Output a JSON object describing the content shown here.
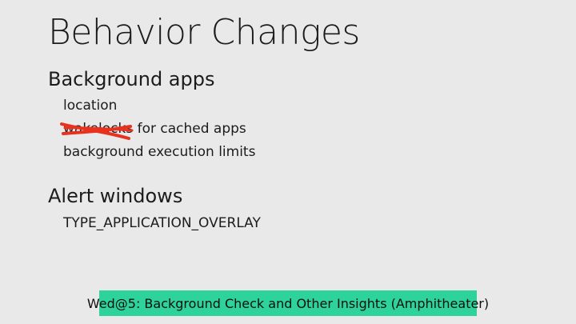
{
  "slide": {
    "title": "Behavior Changes",
    "sections": [
      {
        "heading": "Background apps",
        "items": [
          {
            "text": "location"
          },
          {
            "struck_text": "wakelocks",
            "text": " for cached apps"
          },
          {
            "text": "background execution limits"
          }
        ]
      },
      {
        "heading": "Alert windows",
        "items": [
          {
            "text": "TYPE_APPLICATION_OVERLAY"
          }
        ]
      }
    ]
  },
  "banner": {
    "text": "Wed@5: Background Check and Other Insights (Amphitheater)"
  },
  "colors": {
    "background": "#e9e9e9",
    "text": "#1c1c1c",
    "strike": "#e8321e",
    "banner": "#2dd39a"
  }
}
